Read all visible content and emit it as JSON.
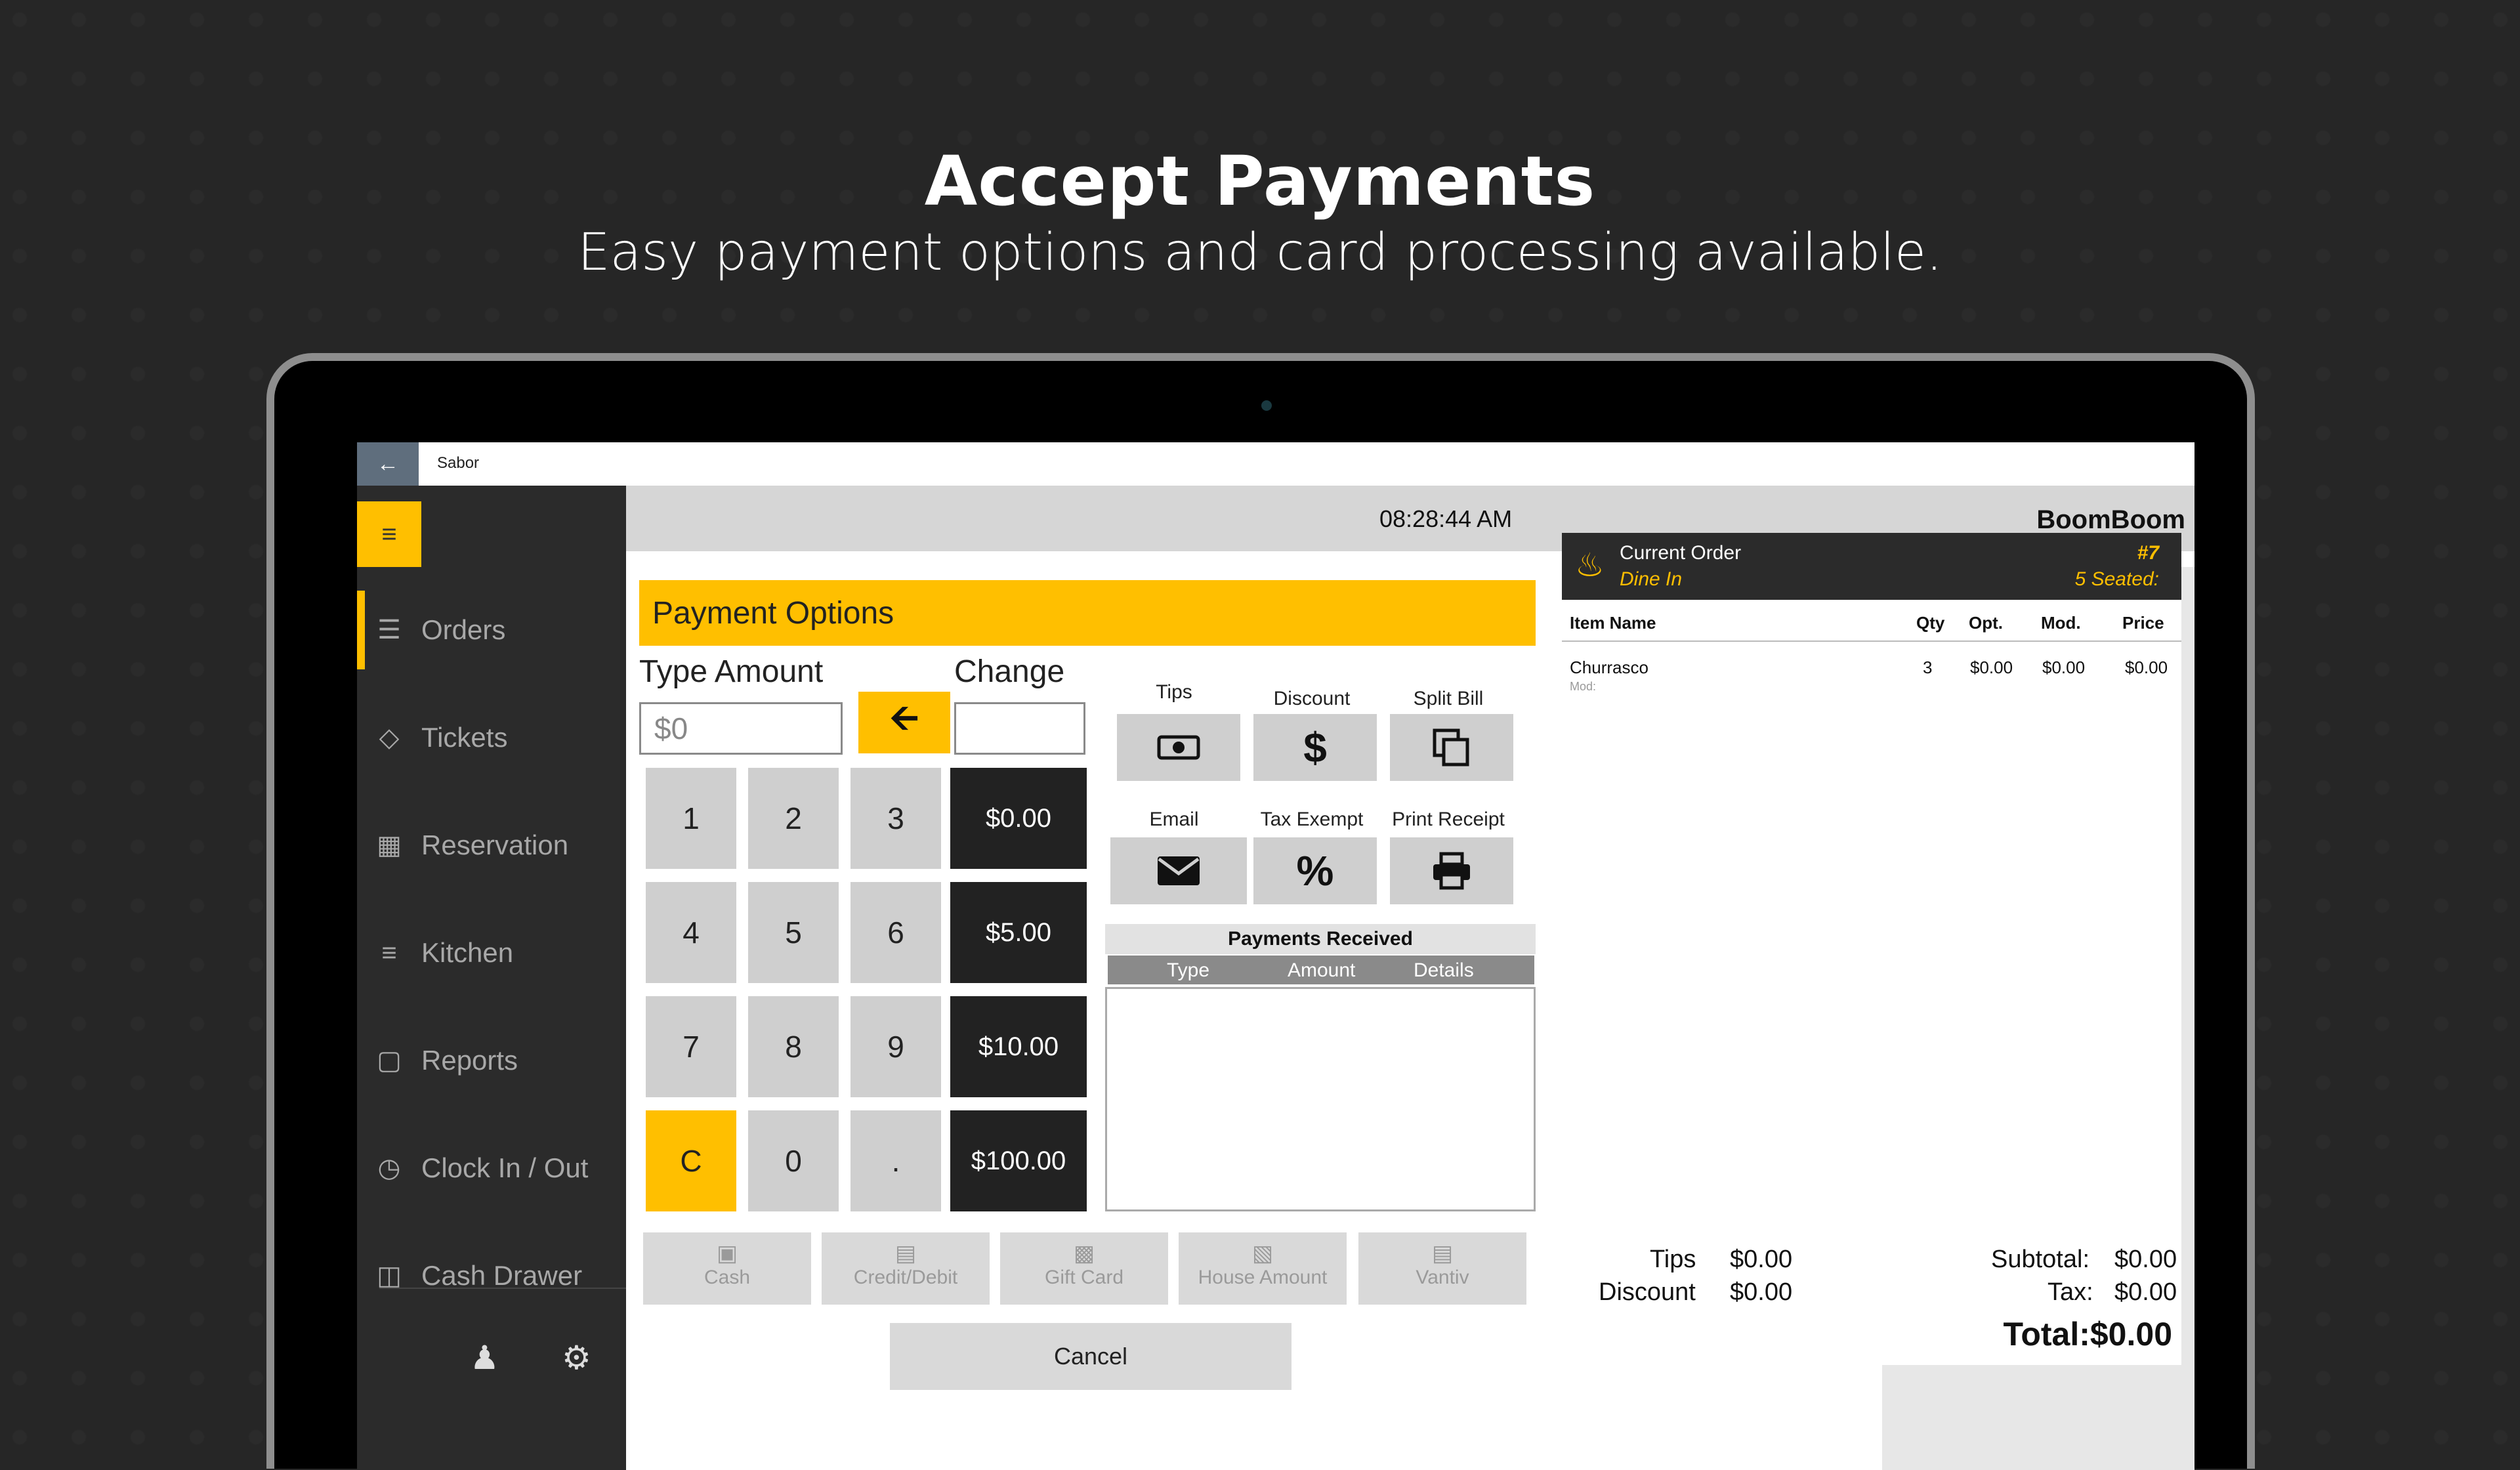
{
  "hero": {
    "title": "Accept Payments",
    "subtitle": "Easy payment options and card processing available."
  },
  "window": {
    "app_name": "Sabor"
  },
  "sidebar": {
    "items": [
      {
        "label": "Orders",
        "icon": "list-icon",
        "active": true
      },
      {
        "label": "Tickets",
        "icon": "tag-icon"
      },
      {
        "label": "Reservation",
        "icon": "calendar-icon"
      },
      {
        "label": "Kitchen",
        "icon": "checklist-icon"
      },
      {
        "label": "Reports",
        "icon": "document-icon"
      },
      {
        "label": "Clock In / Out",
        "icon": "clock-icon"
      },
      {
        "label": "Cash Drawer",
        "icon": "register-icon"
      }
    ]
  },
  "topbar": {
    "time": "08:28:44 AM",
    "store": "BoomBoom"
  },
  "payment": {
    "header": "Payment Options",
    "type_amount_label": "Type Amount",
    "change_label": "Change",
    "amount_placeholder": "$0",
    "keys": [
      "1",
      "2",
      "3",
      "4",
      "5",
      "6",
      "7",
      "8",
      "9",
      "C",
      "0",
      "."
    ],
    "quick_amounts": [
      "$0.00",
      "$5.00",
      "$10.00",
      "$100.00"
    ],
    "options": [
      {
        "label": "Tips",
        "icon": "cash-icon"
      },
      {
        "label": "Discount",
        "icon": "dollar-icon"
      },
      {
        "label": "Split Bill",
        "icon": "copy-icon"
      },
      {
        "label": "Email",
        "icon": "envelope-icon"
      },
      {
        "label": "Tax Exempt",
        "icon": "percent-icon"
      },
      {
        "label": "Print Receipt",
        "icon": "printer-icon"
      }
    ],
    "received_title": "Payments Received",
    "received_columns": [
      "Type",
      "Amount",
      "Details"
    ],
    "methods": [
      "Cash",
      "Credit/Debit",
      "Gift Card",
      "House Amount",
      "Vantiv"
    ],
    "cancel": "Cancel"
  },
  "order": {
    "title": "Current Order",
    "type": "Dine In",
    "number": "#7",
    "seated": "5  Seated:",
    "columns": [
      "Item Name",
      "Qty",
      "Opt.",
      "Mod.",
      "Price"
    ],
    "items": [
      {
        "name": "Churrasco",
        "qty": "3",
        "opt": "$0.00",
        "mod": "$0.00",
        "price": "$0.00",
        "mod_label": "Mod:"
      }
    ],
    "tips_label": "Tips",
    "tips": "$0.00",
    "discount_label": "Discount",
    "discount": "$0.00",
    "subtotal_label": "Subtotal:",
    "subtotal": "$0.00",
    "tax_label": "Tax:",
    "tax": "$0.00",
    "total": "Total:$0.00"
  },
  "colors": {
    "accent": "#ffbf00",
    "dark": "#2b2b2b",
    "key": "#cfcfcf"
  }
}
